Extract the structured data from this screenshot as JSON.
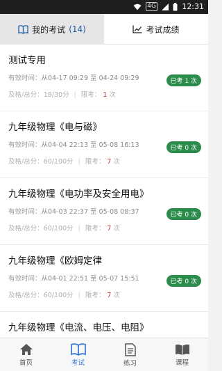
{
  "status_bar": {
    "time": "12:31",
    "sim_badge": "4G",
    "colors": {
      "background": "#1f1f1f"
    }
  },
  "tabs": [
    {
      "label": "我的考试",
      "count": "(14)",
      "icon": "book-icon",
      "active": true
    },
    {
      "label": "考试成绩",
      "icon": "chart-icon",
      "active": false
    }
  ],
  "exams": [
    {
      "title": "测试专用",
      "time_label": "有效时间：",
      "time_value": "从04-17 09:29 至 04-24 09:29",
      "score_label": "及格/总分：",
      "score_value": "18/30分",
      "limit_label": "限考：",
      "limit_value": "1",
      "limit_unit": "次",
      "badge": "已考 1 次"
    },
    {
      "title": "九年级物理《电与磁》",
      "time_label": "有效时间：",
      "time_value": "从04-04 22:13 至 05-08 16:13",
      "score_label": "及格/总分：",
      "score_value": "60/100分",
      "limit_label": "限考：",
      "limit_value": "7",
      "limit_unit": "次",
      "badge": "已考 0 次"
    },
    {
      "title": "九年级物理《电功率及安全用电》",
      "time_label": "有效时间：",
      "time_value": "从04-03 22:37 至 05-08 08:37",
      "score_label": "及格/总分：",
      "score_value": "60/100分",
      "limit_label": "限考：",
      "limit_value": "7",
      "limit_unit": "次",
      "badge": "已考 0 次"
    },
    {
      "title": "九年级物理《欧姆定律",
      "time_label": "有效时间：",
      "time_value": "从04-01 22:51 至 05-07 15:51",
      "score_label": "及格/总分：",
      "score_value": "60/100分",
      "limit_label": "限考：",
      "limit_value": "7",
      "limit_unit": "次",
      "badge": "已考 0 次"
    },
    {
      "title": "九年级物理《电流、电压、电阻》",
      "time_label": "",
      "time_value": "",
      "score_label": "",
      "score_value": "",
      "limit_label": "",
      "limit_value": "",
      "limit_unit": "",
      "badge": ""
    }
  ],
  "bottom_nav": [
    {
      "label": "首页",
      "icon": "home-icon",
      "active": false
    },
    {
      "label": "考试",
      "icon": "book-icon",
      "active": true
    },
    {
      "label": "练习",
      "icon": "document-icon",
      "active": false
    },
    {
      "label": "课程",
      "icon": "open-book-icon",
      "active": false
    }
  ],
  "colors": {
    "accent": "#3b7ad6",
    "badge_green": "#2b8c4b",
    "limit_red": "#d32f2f",
    "tab_active_bg": "#e6e6e6"
  }
}
